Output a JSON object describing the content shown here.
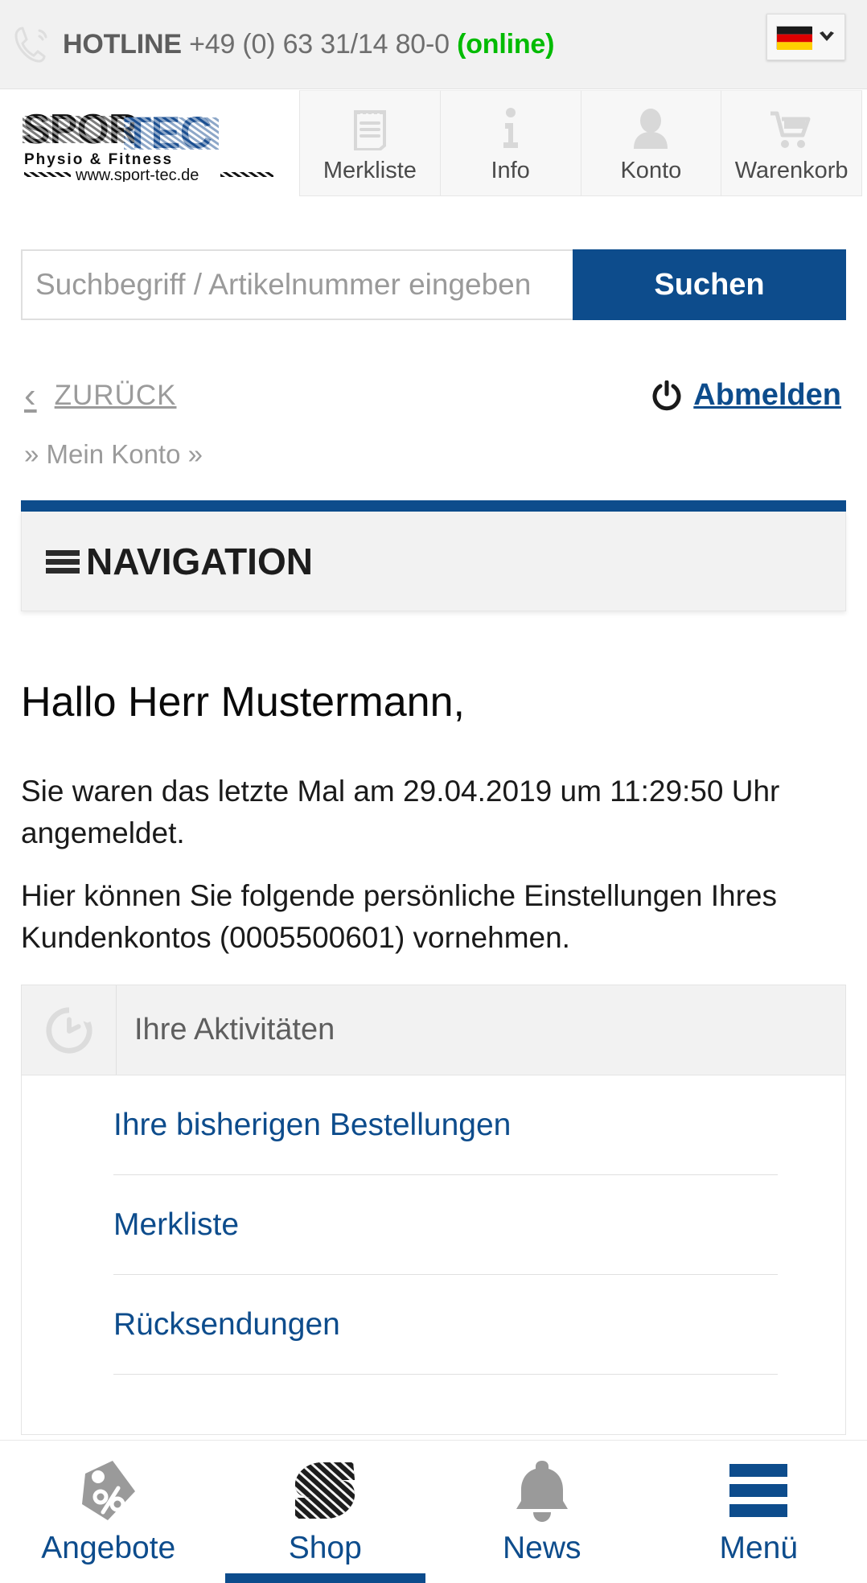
{
  "topbar": {
    "phone_icon": "phone-icon",
    "hotline_label": "HOTLINE",
    "hotline_number": "+49 (0) 63 31/14 80-0",
    "status": "(online)",
    "status_color": "#00bb00",
    "language_flag": "german-flag-icon",
    "language_chevron": "chevron-down-icon"
  },
  "brand": {
    "logo_name": "SPORTEC",
    "logo_tagline": "Physio & Fitness",
    "logo_url_text": "www.sport-tec.de",
    "icon_nav": [
      {
        "label": "Merkliste",
        "icon": "clipboard-list-icon"
      },
      {
        "label": "Info",
        "icon": "info-icon"
      },
      {
        "label": "Konto",
        "icon": "user-account-icon"
      },
      {
        "label": "Warenkorb",
        "icon": "shopping-cart-icon"
      }
    ]
  },
  "search": {
    "placeholder": "Suchbegriff / Artikelnummer eingeben",
    "value": "",
    "button_label": "Suchen",
    "button_color": "#0d4c8c"
  },
  "subnav": {
    "back_label": "ZURÜCK",
    "back_icon": "chevron-left-icon",
    "logout_label": "Abmelden",
    "logout_icon": "power-icon",
    "breadcrumb": "» Mein Konto »"
  },
  "navigation": {
    "label": "NAVIGATION",
    "icon": "hamburger-menu-icon",
    "accent_color": "#0d4c8c"
  },
  "main": {
    "greeting": "Hallo Herr Mustermann,",
    "last_login_text": "Sie waren das letzte Mal am 29.04.2019 um 11:29:50 Uhr angemeldet.",
    "settings_text": "Hier können Sie folgende persönliche Einstellungen Ihres Kundenkontos (0005500601) vornehmen.",
    "last_login_date": "29.04.2019",
    "last_login_time": "11:29:50",
    "customer_number": "0005500601"
  },
  "activities_panel": {
    "title": "Ihre Aktivitäten",
    "icon": "history-clock-icon",
    "links": [
      {
        "label": "Ihre bisherigen Bestellungen"
      },
      {
        "label": "Merkliste"
      },
      {
        "label": "Rücksendungen"
      }
    ]
  },
  "tabbar": {
    "active_index": 1,
    "accent_color": "#0d4c8c",
    "tabs": [
      {
        "label": "Angebote",
        "icon": "price-tag-percent-icon"
      },
      {
        "label": "Shop",
        "icon": "sport-tec-s-logo-icon"
      },
      {
        "label": "News",
        "icon": "bell-icon"
      },
      {
        "label": "Menü",
        "icon": "hamburger-menu-icon"
      }
    ]
  }
}
